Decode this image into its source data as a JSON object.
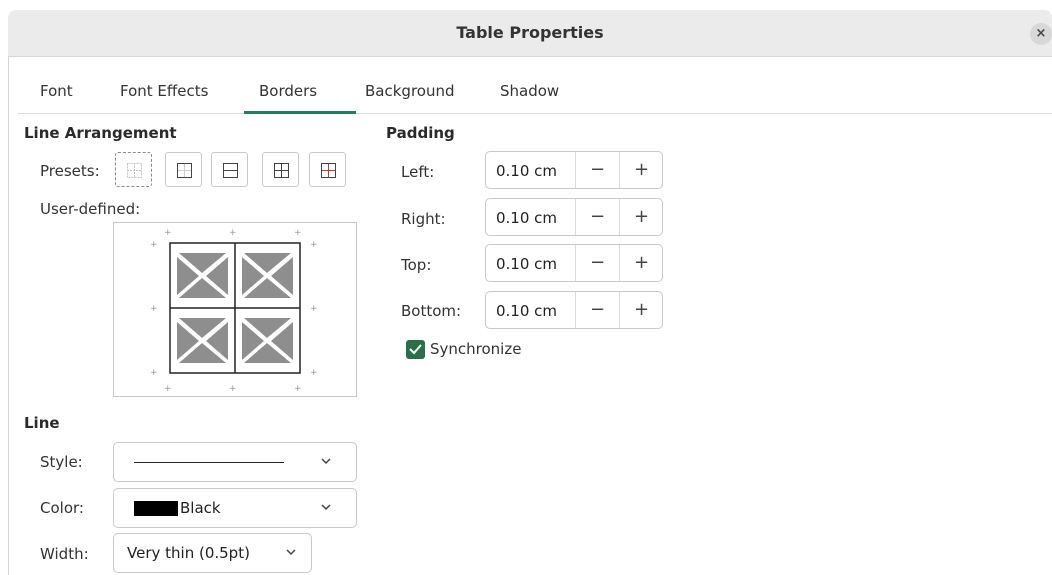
{
  "window": {
    "title": "Table Properties",
    "close_glyph": "×"
  },
  "tabs": [
    {
      "label": "Font"
    },
    {
      "label": "Font Effects"
    },
    {
      "label": "Borders"
    },
    {
      "label": "Background"
    },
    {
      "label": "Shadow"
    }
  ],
  "active_tab": "Borders",
  "line_arrangement": {
    "heading": "Line Arrangement",
    "presets_label": "Presets:",
    "presets": [
      "none-icon",
      "outer-border-icon",
      "outer-border-horizontal-icon",
      "outer-border-all-inner-icon",
      "outer-border-inner-red-icon"
    ],
    "user_defined_label": "User-defined:"
  },
  "padding": {
    "heading": "Padding",
    "fields": [
      {
        "label": "Left:",
        "value": "0.10 cm"
      },
      {
        "label": "Right:",
        "value": "0.10 cm"
      },
      {
        "label": "Top:",
        "value": "0.10 cm"
      },
      {
        "label": "Bottom:",
        "value": "0.10 cm"
      }
    ],
    "minus": "−",
    "plus": "+",
    "synchronize_label": "Synchronize",
    "synchronize_checked": true
  },
  "line": {
    "heading": "Line",
    "style_label": "Style:",
    "color_label": "Color:",
    "color_value": "Black",
    "color_hex": "#000000",
    "width_label": "Width:",
    "width_value": "Very thin (0.5pt)"
  },
  "colors": {
    "accent": "#2b7a5b",
    "checkbox": "#2b6e4a"
  }
}
